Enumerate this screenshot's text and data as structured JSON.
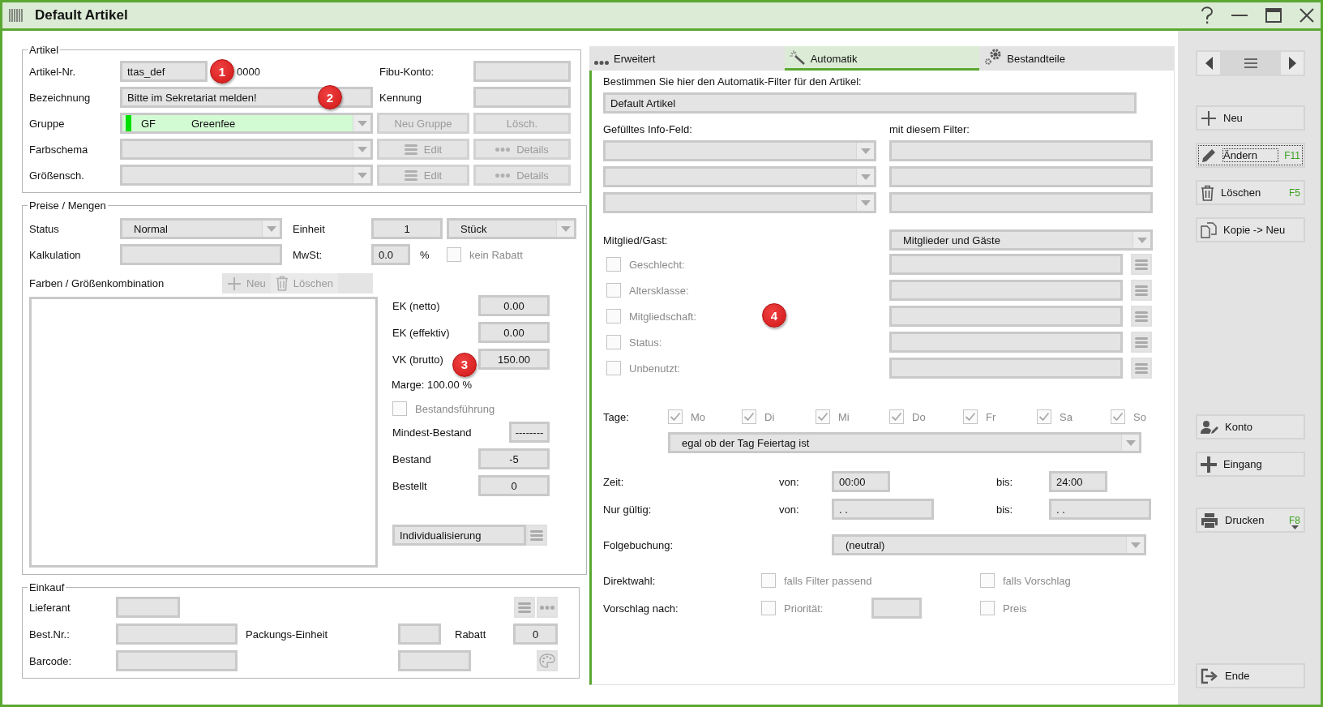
{
  "window": {
    "title": "Default Artikel"
  },
  "artikel": {
    "legend": "Artikel",
    "artikel_nr": {
      "label": "Artikel-Nr.",
      "value": "ttas_def",
      "suffix": "0000"
    },
    "fibu_konto": {
      "label": "Fibu-Konto:"
    },
    "bezeichnung": {
      "label": "Bezeichnung",
      "value": "Bitte im Sekretariat melden!"
    },
    "kennung": {
      "label": "Kennung"
    },
    "gruppe": {
      "label": "Gruppe",
      "code": "GF",
      "name": "Greenfee",
      "color": "#00e000"
    },
    "gruppe_buttons": [
      {
        "label": "Neu Gruppe",
        "disabled": true
      },
      {
        "label": "Lösch.",
        "disabled": true
      }
    ],
    "schemes": [
      {
        "label": "Farbschema",
        "buttons": [
          {
            "label": "Edit",
            "kind": "lines",
            "disabled": true
          },
          {
            "label": "Details",
            "kind": "dots",
            "disabled": true
          }
        ]
      },
      {
        "label": "Größensch.",
        "buttons": [
          {
            "label": "Edit",
            "kind": "lines",
            "disabled": true
          },
          {
            "label": "Details",
            "kind": "dots",
            "disabled": true
          }
        ]
      }
    ]
  },
  "preise": {
    "legend": "Preise / Mengen",
    "status": {
      "label": "Status",
      "value": "Normal"
    },
    "einheit": {
      "label": "Einheit",
      "quantity": "1",
      "unit": "Stück"
    },
    "kalkulation": {
      "label": "Kalkulation"
    },
    "mwst": {
      "label": "MwSt:",
      "value": "0.0",
      "unit": "%"
    },
    "kein_rabatt": {
      "label": "kein Rabatt",
      "checked": false,
      "disabled": true
    },
    "kombination": {
      "label": "Farben / Größenkombination",
      "buttons": [
        {
          "label": "Neu",
          "kind": "plus",
          "disabled": true
        },
        {
          "label": "Löschen",
          "kind": "trash",
          "disabled": true
        }
      ]
    },
    "prices": [
      {
        "label": "EK (netto)",
        "value": "0.00"
      },
      {
        "label": "EK (effektiv)",
        "value": "0.00"
      },
      {
        "label": "VK (brutto)",
        "value": "150.00"
      }
    ],
    "marge": "Marge: 100.00 %",
    "bestandsfuehrung": {
      "label": "Bestandsführung",
      "checked": false,
      "disabled": true
    },
    "stock": [
      {
        "label": "Mindest-Bestand",
        "value": "--------",
        "kind": "short"
      },
      {
        "label": "Bestand",
        "value": "-5",
        "kind": "normal"
      },
      {
        "label": "Bestellt",
        "value": "0",
        "kind": "normal"
      }
    ],
    "individualisierung": "Individualisierung"
  },
  "einkauf": {
    "legend": "Einkauf",
    "lieferant": "Lieferant",
    "best_nr": "Best.Nr.:",
    "packungs_einheit": "Packungs-Einheit",
    "rabatt": {
      "label": "Rabatt",
      "value": "0"
    },
    "barcode": "Barcode:"
  },
  "tabs": [
    {
      "label": "Erweitert",
      "kind": "dots",
      "selected": false
    },
    {
      "label": "Automatik",
      "kind": "wand",
      "selected": true
    },
    {
      "label": "Bestandteile",
      "kind": "gears",
      "selected": false
    }
  ],
  "automatik": {
    "intro": "Bestimmen Sie hier den Automatik-Filter für den Artikel:",
    "filter_name": "Default Artikel",
    "info_label": "Gefülltes Info-Feld:",
    "filter_label": "mit diesem Filter:",
    "mitglied": {
      "label": "Mitglied/Gast:",
      "value": "Mitglieder und Gäste"
    },
    "criteria": [
      {
        "label": "Geschlecht:",
        "checked": false,
        "disabled": true
      },
      {
        "label": "Altersklasse:",
        "checked": false,
        "disabled": true
      },
      {
        "label": "Mitgliedschaft:",
        "checked": false,
        "disabled": true
      },
      {
        "label": "Status:",
        "checked": false,
        "disabled": true
      },
      {
        "label": "Unbenutzt:",
        "checked": false,
        "disabled": true
      }
    ],
    "tage": {
      "label": "Tage:",
      "days": [
        {
          "label": "Mo",
          "checked": true,
          "disabled": true
        },
        {
          "label": "Di",
          "checked": true,
          "disabled": true
        },
        {
          "label": "Mi",
          "checked": true,
          "disabled": true
        },
        {
          "label": "Do",
          "checked": true,
          "disabled": true
        },
        {
          "label": "Fr",
          "checked": true,
          "disabled": true
        },
        {
          "label": "Sa",
          "checked": true,
          "disabled": true
        },
        {
          "label": "So",
          "checked": true,
          "disabled": true
        }
      ],
      "holiday": "egal ob der Tag Feiertag ist"
    },
    "zeit": {
      "label": "Zeit:",
      "from_label": "von:",
      "from": "00:00",
      "to_label": "bis:",
      "to": "24:00"
    },
    "gueltig": {
      "label": "Nur gültig:",
      "from_label": "von:",
      "from": ". .",
      "to_label": "bis:",
      "to": ". ."
    },
    "folgebuchung": {
      "label": "Folgebuchung:",
      "value": "(neutral)"
    },
    "direktwahl": {
      "label": "Direktwahl:",
      "options": [
        {
          "label": "falls Filter passend",
          "checked": false,
          "disabled": true,
          "kind": "plain"
        },
        {
          "label": "falls Vorschlag",
          "checked": false,
          "disabled": true,
          "kind": "plain"
        }
      ]
    },
    "vorschlag": {
      "label": "Vorschlag nach:",
      "options": [
        {
          "label": "Priorität:",
          "checked": false,
          "disabled": true,
          "kind": "field"
        },
        {
          "label": "Preis",
          "checked": false,
          "disabled": true,
          "kind": "plain"
        }
      ]
    }
  },
  "sidebar": {
    "buttons": [
      {
        "label": "Neu",
        "kind": "new",
        "disabled": false,
        "focused": false
      },
      {
        "label": "Ändern",
        "shortcut": "F11",
        "kind": "edit",
        "disabled": false,
        "focused": true
      },
      {
        "label": "Löschen",
        "shortcut": "F5",
        "kind": "delete",
        "disabled": false,
        "focused": false
      },
      {
        "label": "Kopie -> Neu",
        "kind": "copy",
        "disabled": false,
        "focused": false
      },
      {
        "label": "Konto",
        "kind": "account",
        "disabled": false,
        "focused": false
      },
      {
        "label": "Eingang",
        "kind": "incoming",
        "disabled": false,
        "focused": false
      },
      {
        "label": "Drucken",
        "shortcut": "F8",
        "kind": "print",
        "disabled": false,
        "focused": false
      },
      {
        "label": "Ende",
        "kind": "exit",
        "disabled": false,
        "focused": false
      }
    ]
  },
  "callouts": [
    "1",
    "2",
    "3",
    "4"
  ]
}
